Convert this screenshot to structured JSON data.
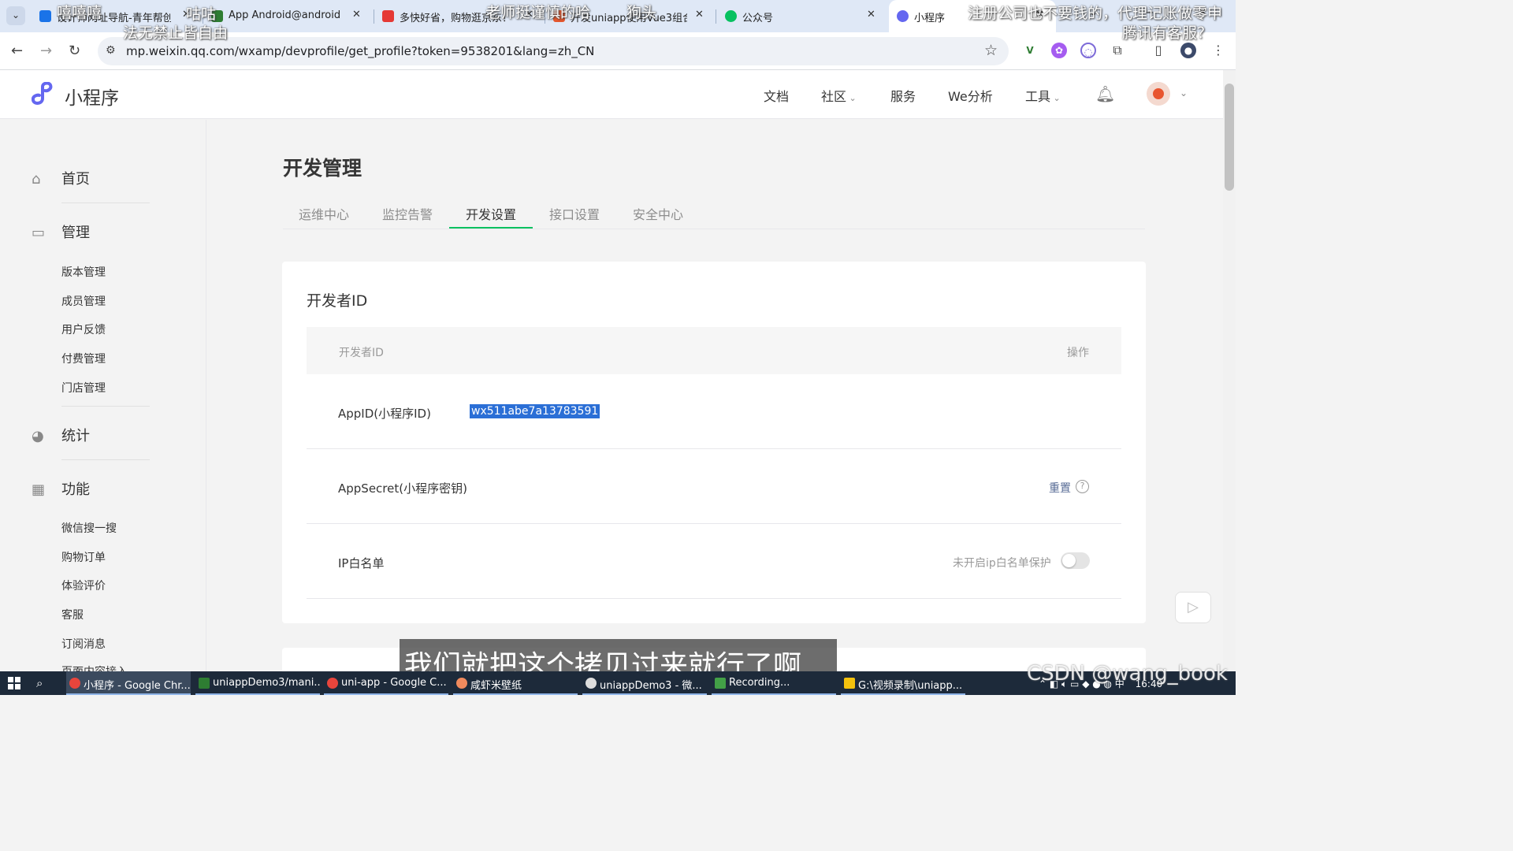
{
  "browser": {
    "tabs": [
      {
        "title": "设计师网址导航-青年帮创",
        "favicon_color": "#1a73e8"
      },
      {
        "title": "App Android@android |",
        "favicon_color": "#2e7d32"
      },
      {
        "title": "多快好省，购物逛京东！",
        "favicon_color": "#e53935"
      },
      {
        "title": "开发uniapp使用Vue3组合",
        "favicon_color": "#e4572e"
      },
      {
        "title": "公众号",
        "favicon_color": "#07c160"
      },
      {
        "title": "小程序",
        "favicon_color": "#6467f0"
      }
    ],
    "url": "mp.weixin.qq.com/wxamp/devprofile/get_profile?token=9538201&lang=zh_CN"
  },
  "header": {
    "logo_text": "小程序",
    "nav": [
      {
        "label": "文档"
      },
      {
        "label": "社区"
      },
      {
        "label": "服务"
      },
      {
        "label": "We分析"
      },
      {
        "label": "工具"
      }
    ]
  },
  "sidebar": {
    "home": "首页",
    "manage": "管理",
    "manage_items": [
      "版本管理",
      "成员管理",
      "用户反馈",
      "付费管理",
      "门店管理"
    ],
    "stats": "统计",
    "features": "功能",
    "feature_items": [
      "微信搜一搜",
      "购物订单",
      "体验评价",
      "客服",
      "订阅消息",
      "页面内容接入"
    ]
  },
  "main": {
    "title": "开发管理",
    "tabs": [
      "运维中心",
      "监控告警",
      "开发设置",
      "接口设置",
      "安全中心"
    ],
    "active_tab": "开发设置",
    "card_title": "开发者ID",
    "table": {
      "col_name": "开发者ID",
      "col_action": "操作",
      "appid_label": "AppID(小程序ID)",
      "appid_value": "wx511abe7a13783591",
      "secret_label": "AppSecret(小程序密钥)",
      "secret_action": "重置",
      "ip_label": "IP白名单",
      "ip_status": "未开启ip白名单保护"
    }
  },
  "overlay": {
    "danmu": [
      "嘻嘻嘻",
      "咕咕",
      "法无禁止皆自由",
      "老师挺谨慎的哈",
      "狗头",
      "注册公司也不要钱的，代理记账做零申",
      "腾讯有客服？"
    ],
    "subtitle": "我们就把这个拷贝过来就行了啊",
    "watermark": "CSDN @wang_book"
  },
  "taskbar": {
    "items": [
      {
        "label": "小程序 - Google Chr...",
        "color": "#e8453c"
      },
      {
        "label": "uniappDemo3/mani...",
        "color": "#2e7d32"
      },
      {
        "label": "uni-app - Google C...",
        "color": "#e8453c"
      },
      {
        "label": "咸虾米壁纸",
        "color": "#f08a5d"
      },
      {
        "label": "uniappDemo3 - 微...",
        "color": "#dddddd"
      },
      {
        "label": "Recording...",
        "color": "#43a047"
      },
      {
        "label": "G:\\视频录制\\uniapp...",
        "color": "#f4c20d"
      }
    ],
    "time": "16:40"
  }
}
